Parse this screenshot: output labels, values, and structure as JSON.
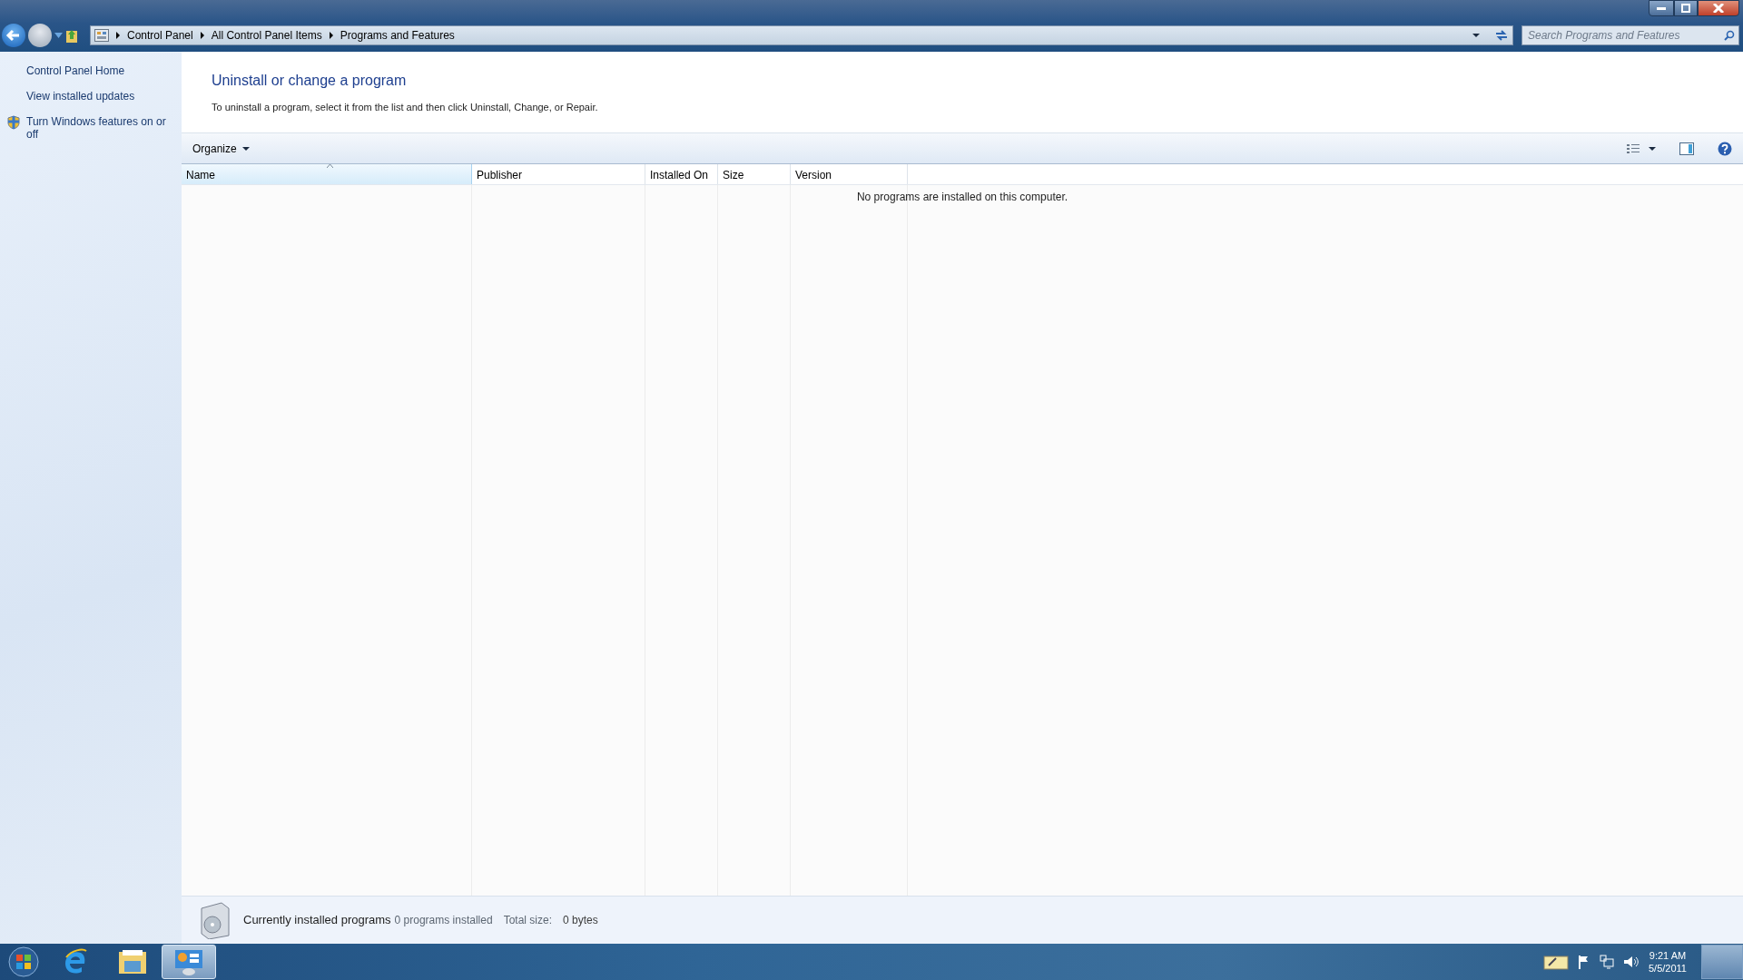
{
  "address_bar": {
    "breadcrumbs": [
      "Control Panel",
      "All Control Panel Items",
      "Programs and Features"
    ]
  },
  "search": {
    "placeholder": "Search Programs and Features"
  },
  "sidebar": {
    "items": [
      {
        "label": "Control Panel Home",
        "shield": false
      },
      {
        "label": "View installed updates",
        "shield": false
      },
      {
        "label": "Turn Windows features on or off",
        "shield": true
      }
    ]
  },
  "heading": "Uninstall or change a program",
  "instructions": "To uninstall a program, select it from the list and then click Uninstall, Change, or Repair.",
  "toolbar": {
    "organize": "Organize"
  },
  "table": {
    "columns": [
      {
        "label": "Name",
        "sorted": true
      },
      {
        "label": "Publisher",
        "sorted": false
      },
      {
        "label": "Installed On",
        "sorted": false
      },
      {
        "label": "Size",
        "sorted": false
      },
      {
        "label": "Version",
        "sorted": false
      }
    ],
    "empty_message": "No programs are installed on this computer."
  },
  "status_bar": {
    "title": "Currently installed programs",
    "count": "0 programs installed",
    "size_label": "Total size:",
    "size_value": "0 bytes"
  },
  "taskbar": {
    "items": [
      {
        "kind": "ie",
        "selected": false
      },
      {
        "kind": "folder",
        "selected": false
      },
      {
        "kind": "control-panel",
        "selected": true
      }
    ],
    "time": "9:21 AM",
    "date": "5/5/2011"
  }
}
